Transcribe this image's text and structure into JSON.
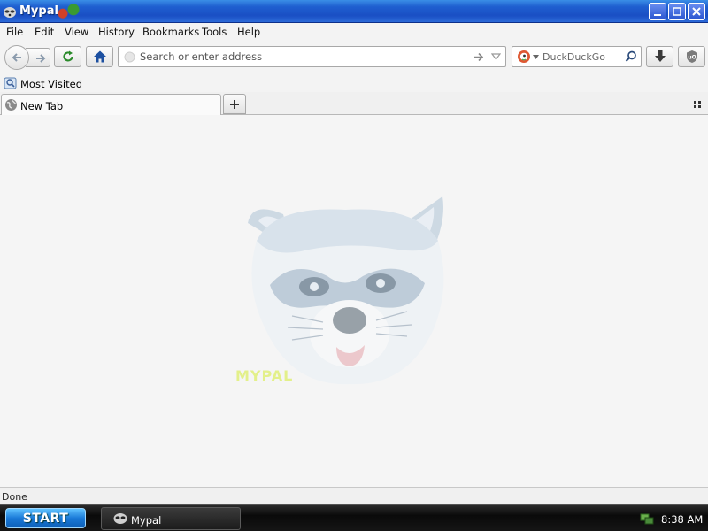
{
  "window": {
    "title": "Mypal"
  },
  "menubar": {
    "items": [
      "File",
      "Edit",
      "View",
      "History",
      "Bookmarks",
      "Tools",
      "Help"
    ]
  },
  "navbar": {
    "url_placeholder": "Search or enter address",
    "search_placeholder": "DuckDuckGo"
  },
  "bookmarks": {
    "items": [
      {
        "label": "Most Visited"
      }
    ]
  },
  "tabs": [
    {
      "label": "New Tab",
      "active": true
    }
  ],
  "content": {
    "mascot_text": "MYPAL"
  },
  "statusbar": {
    "text": "Done"
  },
  "taskbar": {
    "start_label": "START",
    "items": [
      {
        "label": "Mypal"
      }
    ],
    "clock": "8:38 AM"
  },
  "colors": {
    "titlebar": "#1f5fd0",
    "accent": "#2a55d0",
    "start_button": "#1a7ad8",
    "taskbar": "#151515",
    "mascot_text": "#e3f08a"
  },
  "icons": {
    "app": "raccoon-icon",
    "back": "arrow-left-icon",
    "forward": "arrow-right-icon",
    "reload": "reload-icon",
    "home": "home-icon",
    "go": "go-arrow-icon",
    "dropdown": "chevron-down-icon",
    "search_engine": "duckduckgo-icon",
    "search": "magnifier-icon",
    "download": "download-icon",
    "ublock": "shield-icon",
    "bookmark": "bookmark-folder-icon",
    "tab": "globe-icon",
    "new_tab": "plus-icon",
    "tab_list": "grid-icon",
    "tray": "network-icon"
  }
}
